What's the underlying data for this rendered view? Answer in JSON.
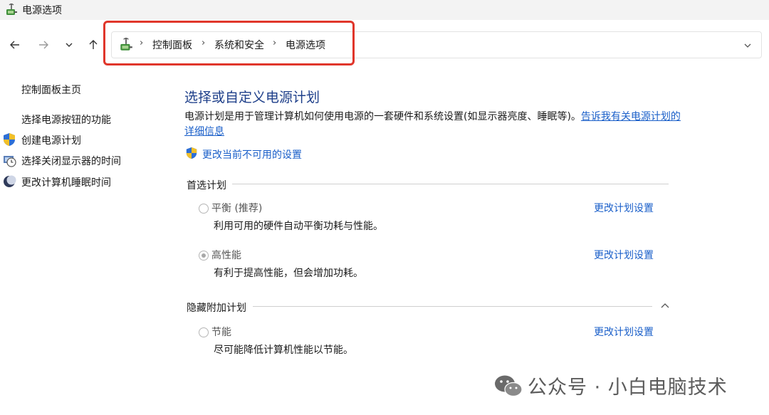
{
  "window": {
    "title": "电源选项"
  },
  "breadcrumb": {
    "items": [
      "控制面板",
      "系统和安全",
      "电源选项"
    ],
    "separator": "›"
  },
  "sidebar": {
    "home": "控制面板主页",
    "items": [
      {
        "label": "选择电源按钮的功能",
        "icon": ""
      },
      {
        "label": "创建电源计划",
        "icon": "shield-icon"
      },
      {
        "label": "选择关闭显示器的时间",
        "icon": "monitor-clock-icon"
      },
      {
        "label": "更改计算机睡眠时间",
        "icon": "moon-icon"
      }
    ]
  },
  "main": {
    "title": "选择或自定义电源计划",
    "description": "电源计划是用于管理计算机如何使用电源的一套硬件和系统设置(如显示器亮度、睡眠等)。",
    "description_link": "告诉我有关电源计划的详细信息",
    "change_unavailable": "更改当前不可用的设置",
    "preferred_section": "首选计划",
    "hidden_section": "隐藏附加计划",
    "plans": [
      {
        "name": "平衡 (推荐)",
        "desc": "利用可用的硬件自动平衡功耗与性能。",
        "link": "更改计划设置",
        "selected": false
      },
      {
        "name": "高性能",
        "desc": "有利于提高性能，但会增加功耗。",
        "link": "更改计划设置",
        "selected": true
      },
      {
        "name": "节能",
        "desc": "尽可能降低计算机性能以节能。",
        "link": "更改计划设置",
        "selected": false
      }
    ]
  },
  "watermark": {
    "text": "公众号 · 小白电脑技术"
  },
  "colors": {
    "link": "#1a5fc9",
    "title": "#1e3f8a",
    "highlight": "#e0362b"
  }
}
